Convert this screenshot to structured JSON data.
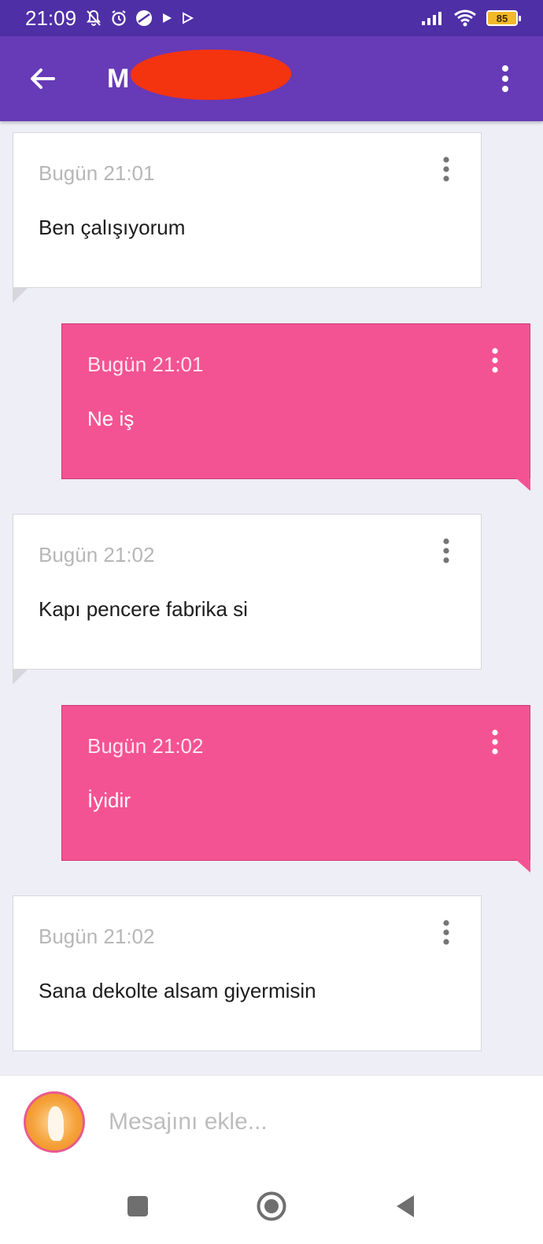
{
  "status_bar": {
    "time": "21:09",
    "battery": "85",
    "left_icons": [
      "muted-bell-icon",
      "alarm-icon",
      "app-icon",
      "play-icon",
      "play-icon"
    ],
    "right_icons": [
      "signal-icon",
      "wifi-icon",
      "battery-icon"
    ]
  },
  "app_bar": {
    "title": "M",
    "color": "#673ab7"
  },
  "messages": [
    {
      "direction": "in",
      "time": "Bugün 21:01",
      "text": "Ben çalışıyorum"
    },
    {
      "direction": "out",
      "time": "Bugün 21:01",
      "text": "Ne iş"
    },
    {
      "direction": "in",
      "time": "Bugün 21:02",
      "text": "Kapı pencere fabrika si"
    },
    {
      "direction": "out",
      "time": "Bugün 21:02",
      "text": "İyidir"
    },
    {
      "direction": "in",
      "time": "Bugün 21:02",
      "text": "Sana dekolte alsam giyermisin"
    }
  ],
  "composer": {
    "placeholder": "Mesajını ekle..."
  },
  "colors": {
    "outgoing_bubble": "#f45393",
    "incoming_bubble": "#ffffff",
    "status_bar": "#4f2fa6",
    "background": "#eeeef7"
  },
  "nav": [
    "recent-apps-icon",
    "home-icon",
    "back-icon"
  ]
}
